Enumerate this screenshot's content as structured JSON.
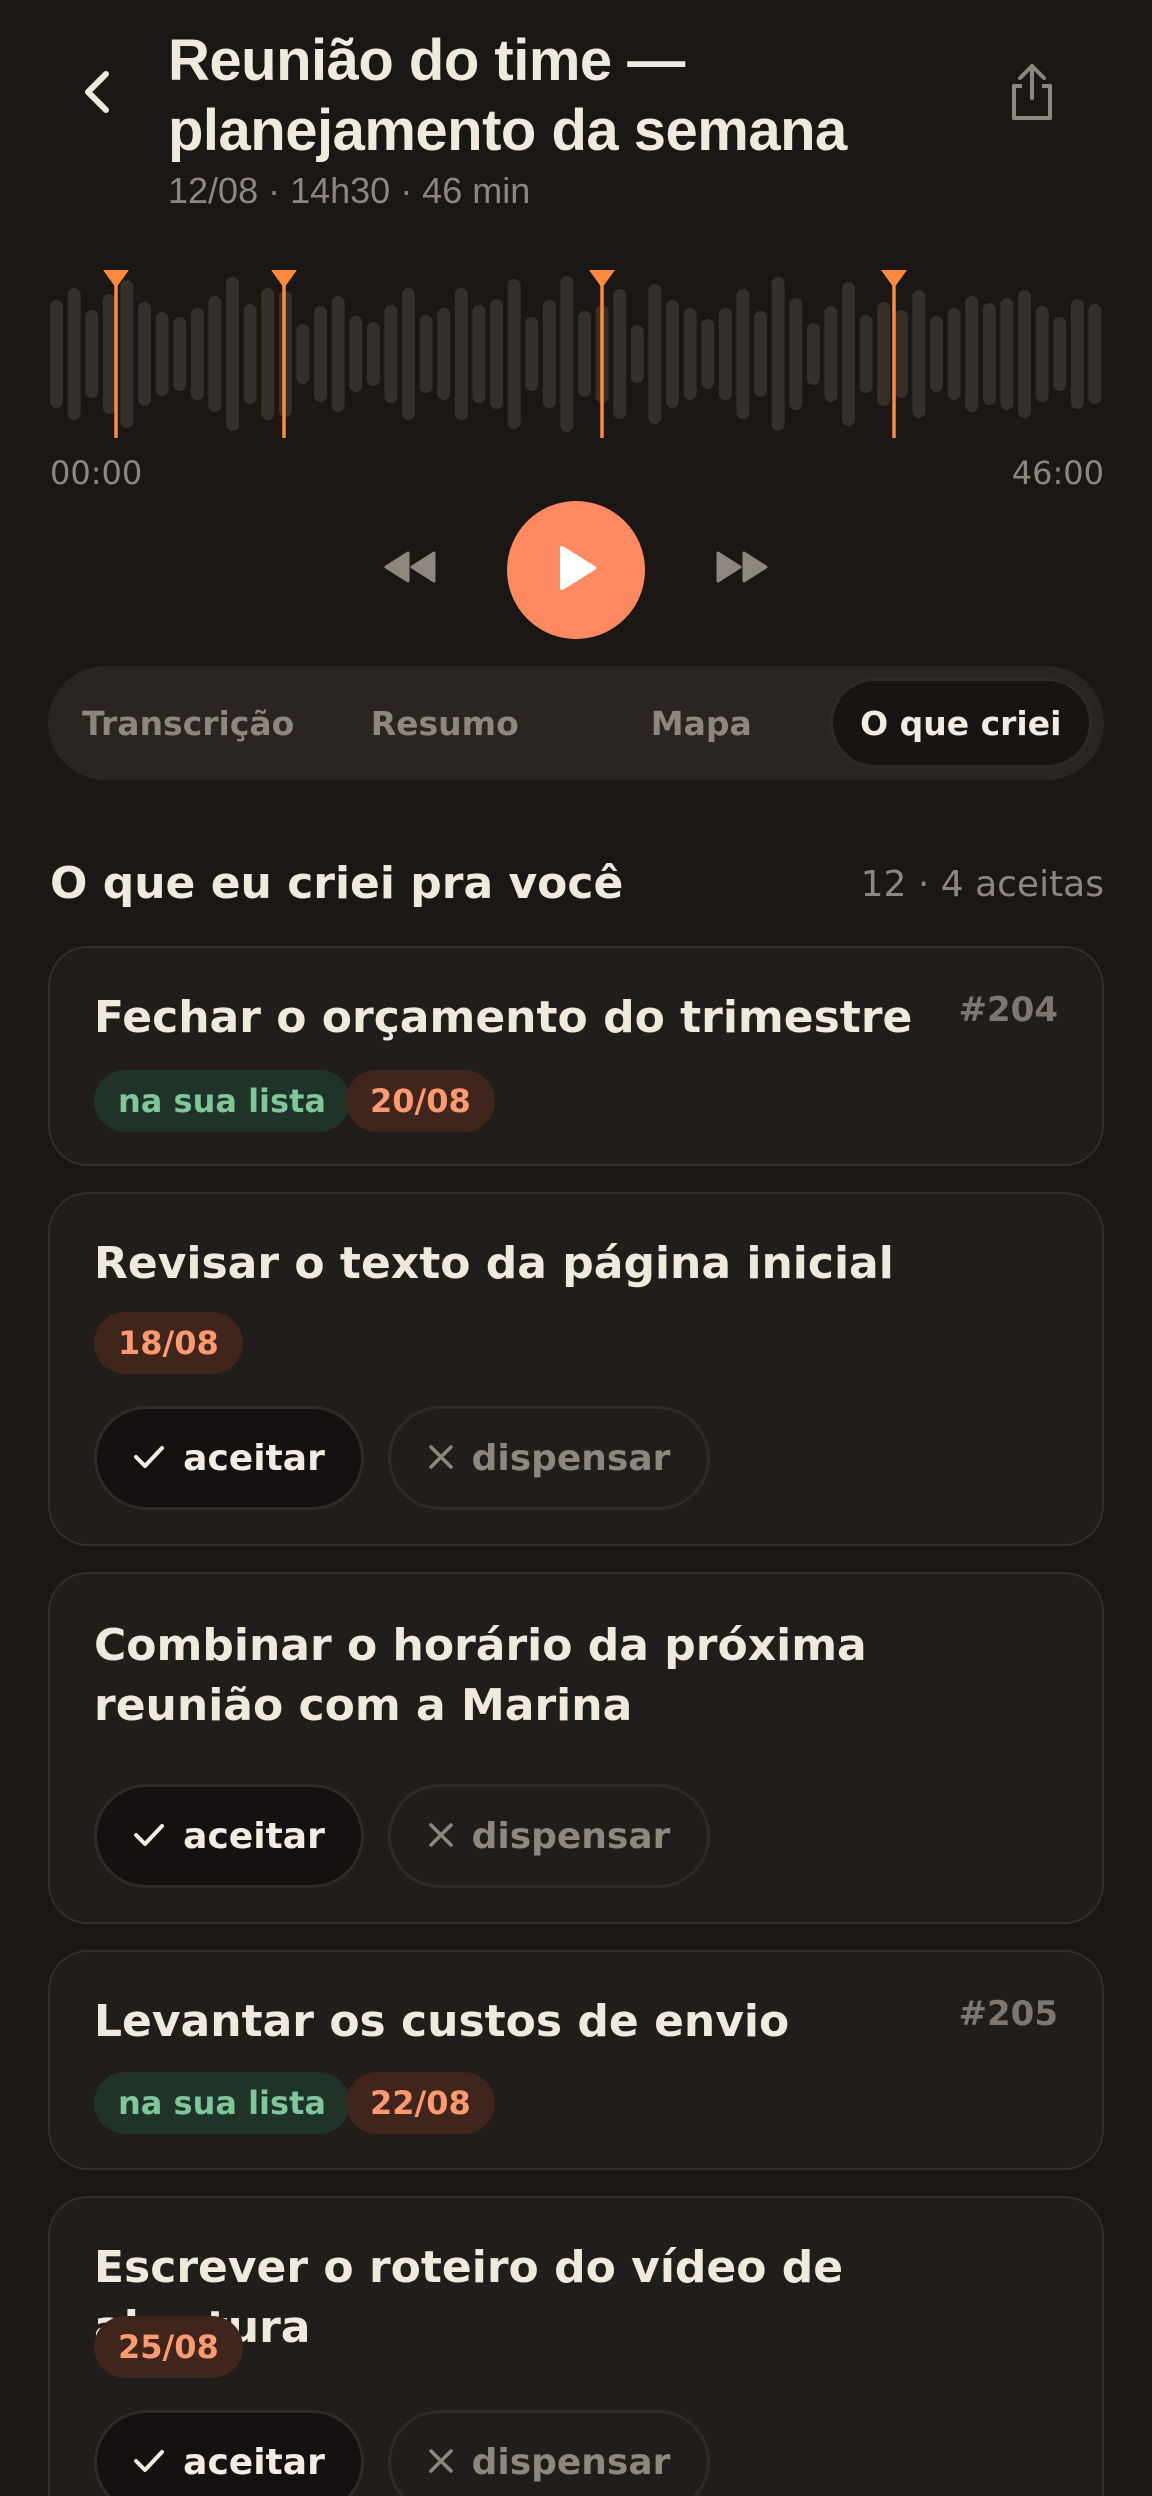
{
  "header": {
    "title": "Reunião do time — planejamento da semana",
    "meta": "12/08 · 14h30 · 46 min",
    "back_icon": "chevron-left-icon",
    "share_icon": "share-icon"
  },
  "player": {
    "time_start": "00:00",
    "time_end": "46:00",
    "play_icon": "play-icon",
    "rewind_icon": "rewind-icon",
    "forward_icon": "fast-forward-icon",
    "accent": "#ff8a62"
  },
  "tabs": [
    {
      "label": "Transcrição",
      "active": false
    },
    {
      "label": "Resumo",
      "active": false
    },
    {
      "label": "Mapa",
      "active": false
    },
    {
      "label": "O que criei",
      "active": true
    }
  ],
  "section": {
    "title": "O que eu criei pra você",
    "count": "12 · 4 aceitas"
  },
  "cards": [
    {
      "title": "Fechar o orçamento do trimestre",
      "id": "#204",
      "status": "na sua lista",
      "date": "20/08"
    },
    {
      "title": "Revisar o texto da página inicial",
      "date": "18/08",
      "accept": "aceitar",
      "dismiss": "dispensar"
    },
    {
      "title": "Combinar o horário da próxima reunião com a Marina",
      "accept": "aceitar",
      "dismiss": "dispensar"
    },
    {
      "title": "Levantar os custos de envio",
      "id": "#205",
      "status": "na sua lista",
      "date": "22/08"
    },
    {
      "title": "Escrever o roteiro do vídeo de abertura",
      "date": "25/08",
      "accept": "aceitar",
      "dismiss": "dispensar"
    }
  ]
}
